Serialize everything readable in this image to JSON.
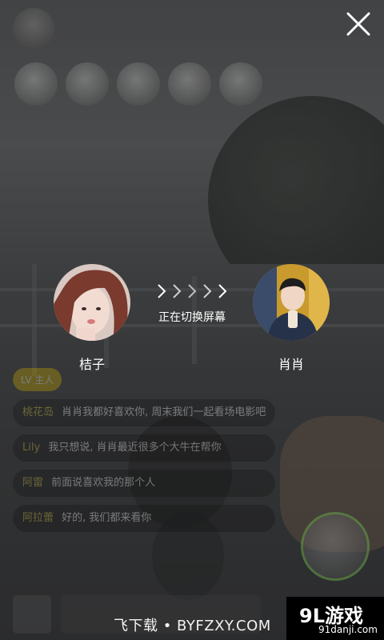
{
  "switch": {
    "left_name": "桔子",
    "right_name": "肖肖",
    "status_text": "正在切换屏幕"
  },
  "icons": {
    "close": "close-icon",
    "arrows": "chevron-right-icon"
  },
  "chat": {
    "tag": "LV 主人",
    "messages": [
      {
        "user": "桃花岛",
        "text": "肖肖我都好喜欢你, 周末我们一起看场电影吧"
      },
      {
        "user": "Lily",
        "text": "我只想说, 肖肖最近很多个大牛在帮你"
      },
      {
        "user": "阿雷",
        "text": "前面说喜欢我的那个人"
      },
      {
        "user": "阿拉蕾",
        "text": "好的, 我们都来看你"
      }
    ]
  },
  "watermark": {
    "text": "飞下载 • BYFZXY.COM"
  },
  "logo": {
    "big": "9L游戏",
    "small": "91danji.com"
  },
  "colors": {
    "accent_tag": "#c8a800",
    "chat_user": "#d6c640",
    "mini_avatar_ring": "#6aa64a"
  }
}
